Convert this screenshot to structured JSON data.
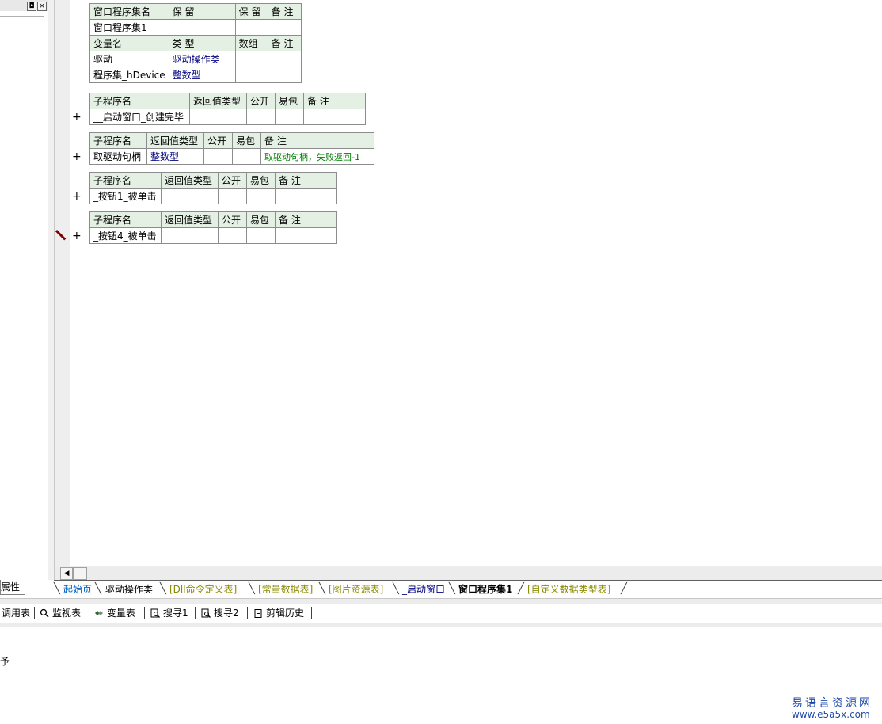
{
  "left_panel": {
    "tab_label": "属性",
    "close_glyph": "×",
    "restore_glyph": "◘"
  },
  "assembly_table": {
    "header1": [
      "窗口程序集名",
      "保 留",
      "保 留",
      "备 注"
    ],
    "row1": [
      "窗口程序集1",
      "",
      "",
      ""
    ],
    "header2": [
      "变量名",
      "类 型",
      "数组",
      "备 注"
    ],
    "vars": [
      [
        "驱动",
        "驱动操作类",
        "",
        ""
      ],
      [
        "程序集_hDevice",
        "整数型",
        "",
        ""
      ]
    ]
  },
  "subs": [
    {
      "header": [
        "子程序名",
        "返回值类型",
        "公开",
        "易包",
        "备 注"
      ],
      "row": [
        "__启动窗口_创建完毕",
        "",
        "",
        "",
        ""
      ]
    },
    {
      "header": [
        "子程序名",
        "返回值类型",
        "公开",
        "易包",
        "备 注"
      ],
      "row": [
        "取驱动句柄",
        "整数型",
        "",
        "",
        "取驱动句柄，失败返回-1"
      ]
    },
    {
      "header": [
        "子程序名",
        "返回值类型",
        "公开",
        "易包",
        "备 注"
      ],
      "row": [
        "_按钮1_被单击",
        "",
        "",
        "",
        ""
      ]
    },
    {
      "header": [
        "子程序名",
        "返回值类型",
        "公开",
        "易包",
        "备 注"
      ],
      "row": [
        "_按钮4_被单击",
        "",
        "",
        "",
        ""
      ]
    }
  ],
  "plus": "+",
  "scroll_left_glyph": "◀",
  "tabs": [
    "起始页",
    "驱动操作类",
    "[Dll命令定义表]",
    "[常量数据表]",
    "[图片资源表]",
    "_启动窗口",
    "窗口程序集1",
    "[自定义数据类型表]"
  ],
  "toolbar": [
    "调用表",
    "监视表",
    "变量表",
    "搜寻1",
    "搜寻2",
    "剪辑历史"
  ],
  "output_text": "予",
  "watermark": {
    "line1": "易语言资源网",
    "line2": "www.e5a5x.com"
  },
  "colors": {
    "header_bg": "#e4f0e4",
    "type_text": "#000080",
    "comment_text": "#008000",
    "link_tab": "#0060c0"
  }
}
